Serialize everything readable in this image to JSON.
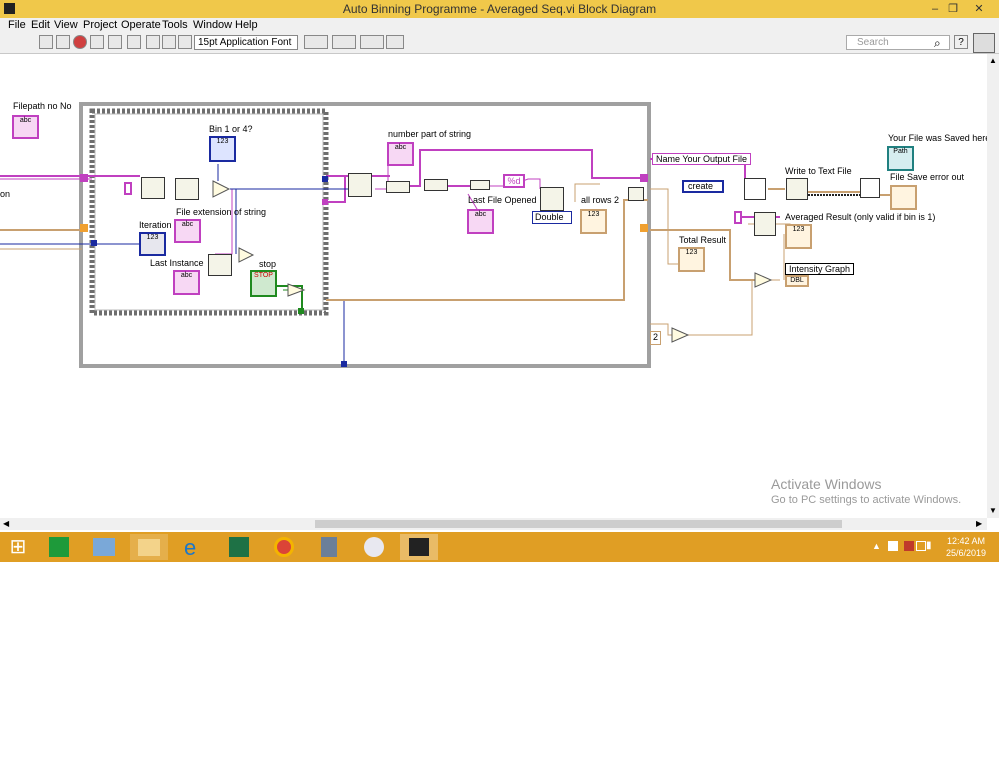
{
  "window": {
    "title": "Auto Binning Programme - Averaged Seq.vi Block Diagram",
    "controls": [
      "–",
      "❐",
      "✕"
    ]
  },
  "menu": [
    "File",
    "Edit",
    "View",
    "Project",
    "Operate",
    "Tools",
    "Window",
    "Help"
  ],
  "toolbar": {
    "font": "15pt Application Font",
    "search_placeholder": "Search",
    "help": "?"
  },
  "diagram": {
    "labels": {
      "filepath": "Filepath no No",
      "on": "on",
      "bin": "Bin 1 or 4?",
      "iteration": "Iteration",
      "file_ext": "File extension of string",
      "last_instance": "Last Instance",
      "stop": "stop",
      "number_part": "number part of string",
      "last_file": "Last File Opened",
      "all_rows": "all rows 2",
      "name_output": "Name Your Output File",
      "write_text": "Write to Text File",
      "saved_here": "Your File was Saved here",
      "file_save_err": "File Save error out",
      "averaged": "Averaged Result (only valid if bin is 1)",
      "total_result": "Total Result",
      "intensity": "Intensity Graph"
    },
    "ring_create": "create",
    "format_spec": "%d",
    "type_double": "Double",
    "const_two": "2",
    "term_text": {
      "abc": "abc",
      "num": "123",
      "path": "Path",
      "dbl": "DBL",
      "stop": "STOP",
      "tf": "TF"
    }
  },
  "watermark": {
    "line1": "Activate Windows",
    "line2": "Go to PC settings to activate Windows."
  },
  "taskbar": {
    "time": "12:42 AM",
    "date": "25/6/2019"
  },
  "colors": {
    "titlebar": "#f0c84a",
    "taskbar": "#e09e24",
    "wire_string": "#c040c0",
    "wire_numeric": "#1a2aa0",
    "wire_cluster": "#c8a070",
    "wire_bool": "#1f8a1f"
  }
}
